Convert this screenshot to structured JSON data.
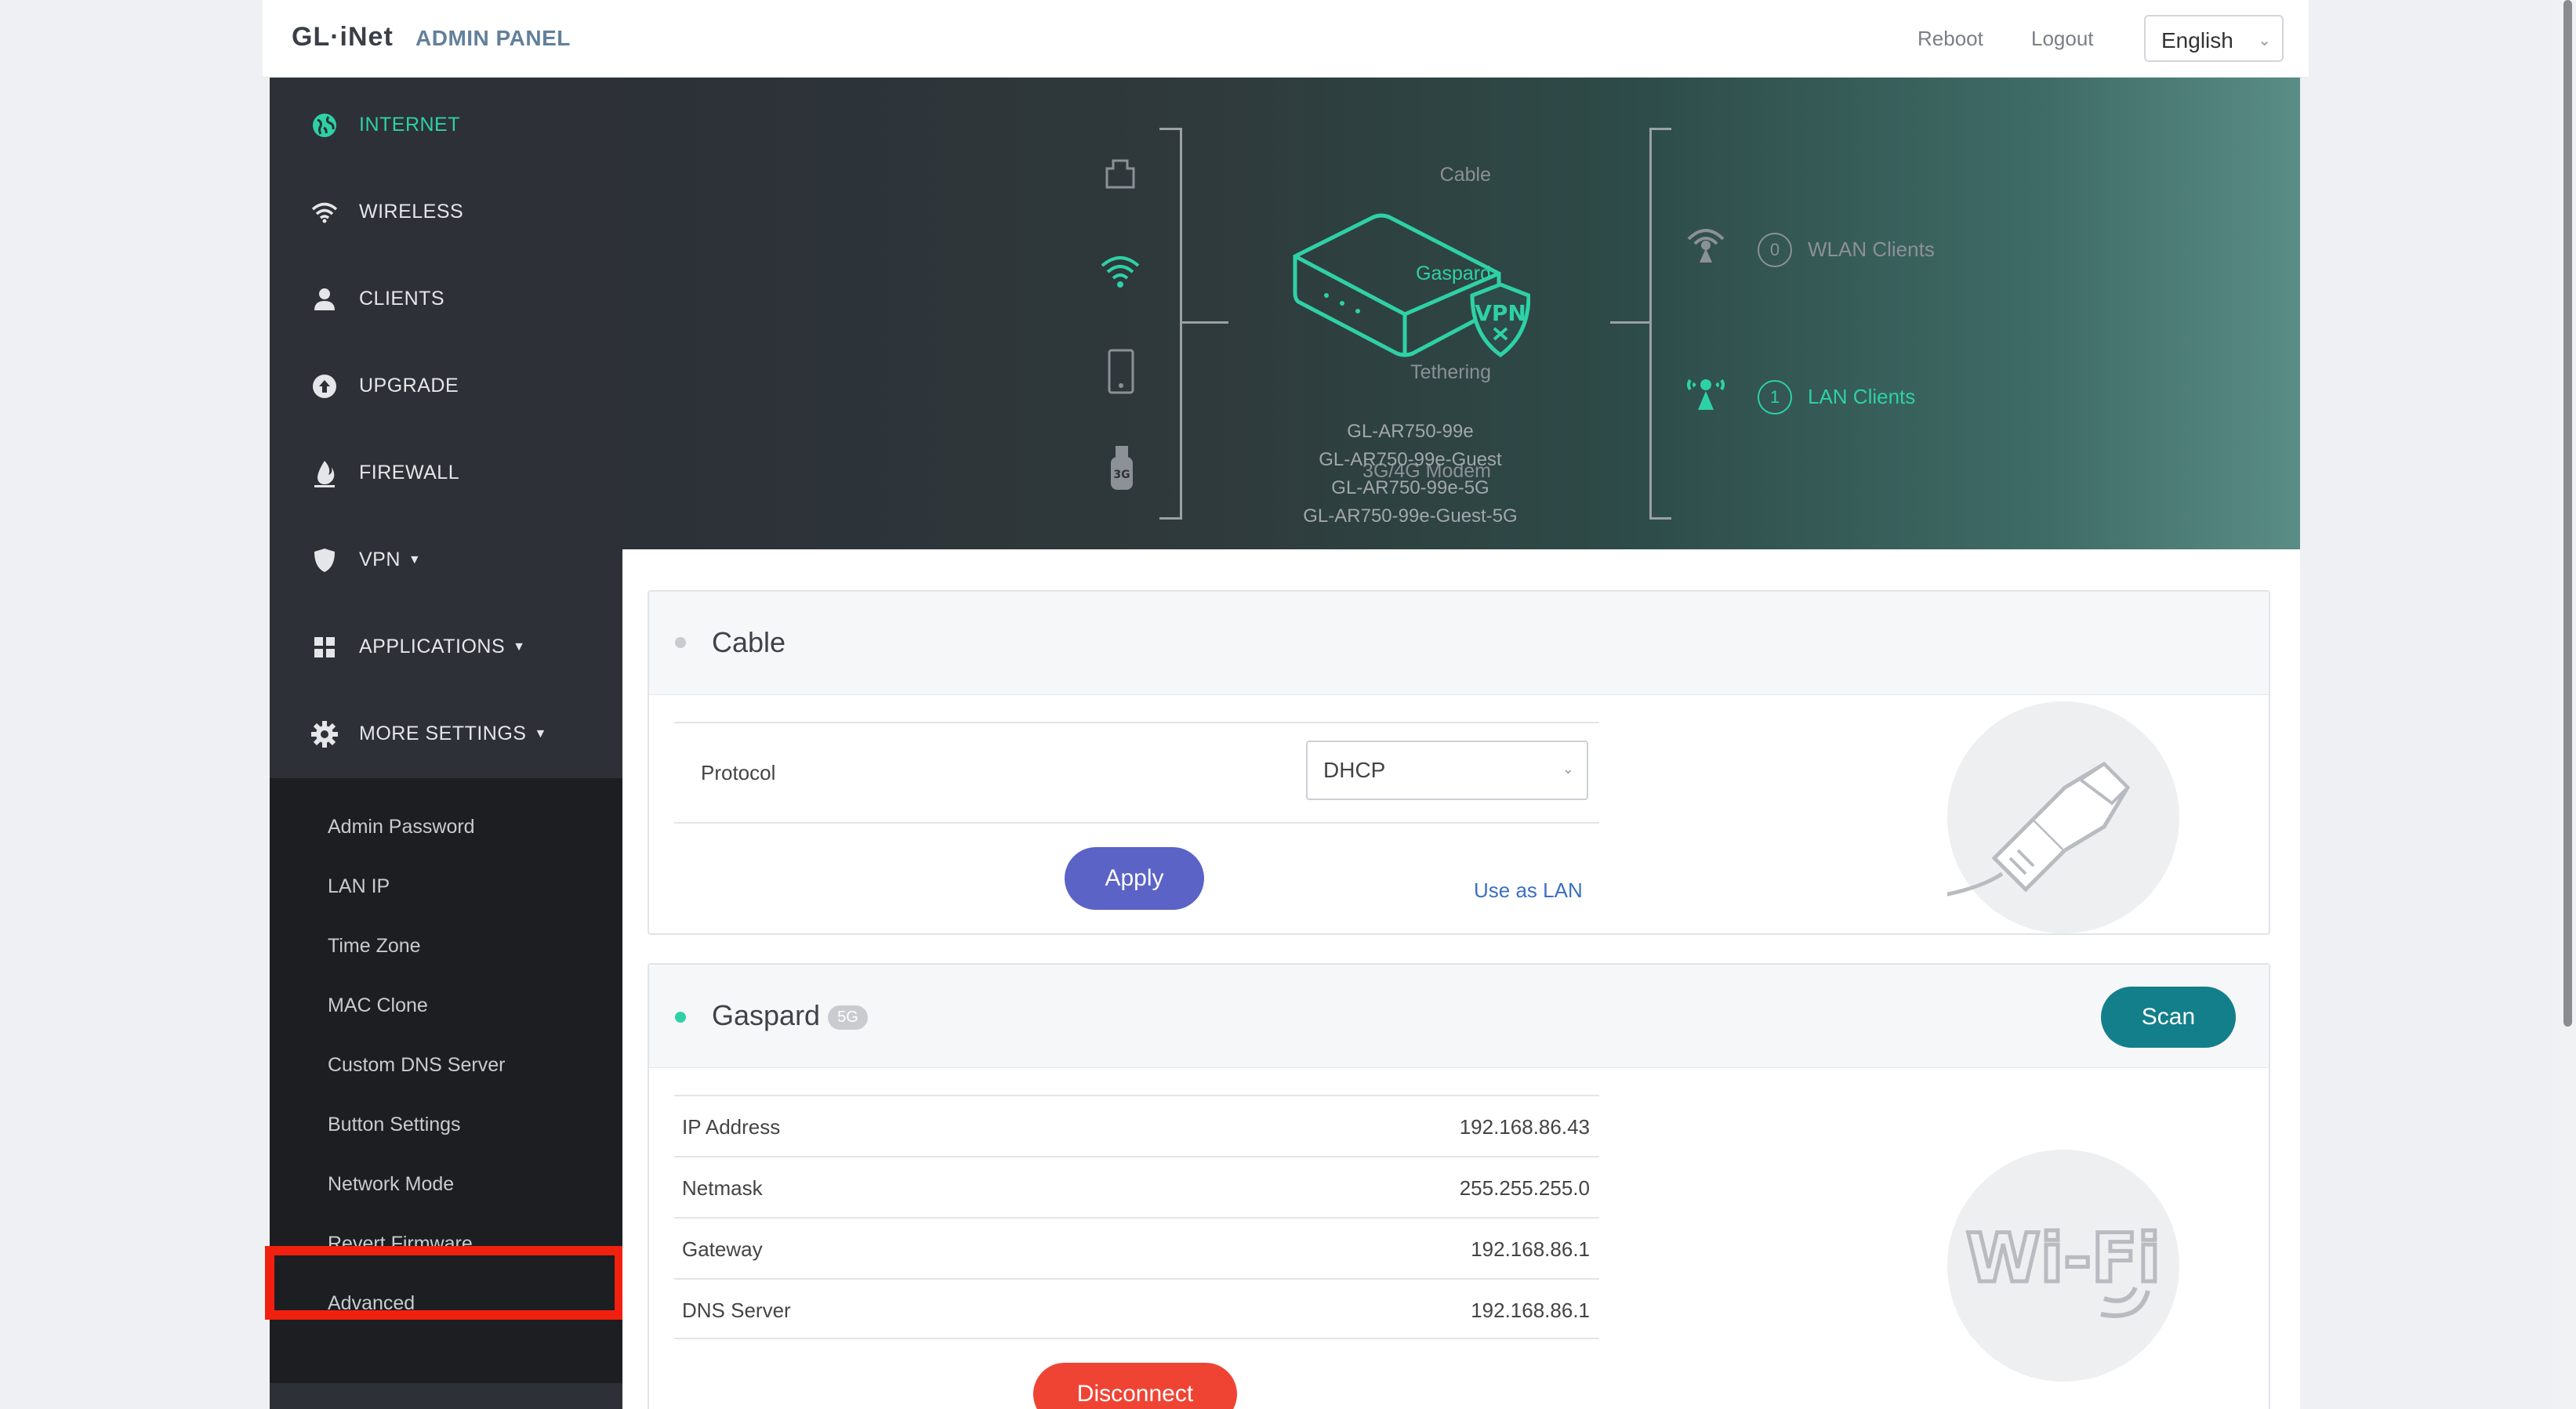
{
  "header": {
    "logo_text": "GL·iNet",
    "title": "ADMIN PANEL",
    "reboot": "Reboot",
    "logout": "Logout",
    "language": "English"
  },
  "sidebar": {
    "items": [
      {
        "label": "INTERNET",
        "icon": "globe-icon",
        "active": true
      },
      {
        "label": "WIRELESS",
        "icon": "wifi-icon"
      },
      {
        "label": "CLIENTS",
        "icon": "user-icon"
      },
      {
        "label": "UPGRADE",
        "icon": "upload-icon"
      },
      {
        "label": "FIREWALL",
        "icon": "flame-icon"
      },
      {
        "label": "VPN",
        "icon": "shield-icon"
      },
      {
        "label": "APPLICATIONS",
        "icon": "grid-icon"
      },
      {
        "label": "MORE SETTINGS",
        "icon": "gear-icon"
      }
    ],
    "sub_items": [
      "Admin Password",
      "LAN IP",
      "Time Zone",
      "MAC Clone",
      "Custom DNS Server",
      "Button Settings",
      "Network Mode",
      "Revert Firmware",
      "Advanced"
    ]
  },
  "hero": {
    "sources": [
      {
        "label": "Cable",
        "icon": "ethernet-port-icon"
      },
      {
        "label": "Gaspard",
        "icon": "wifi-icon",
        "active": true
      },
      {
        "label": "Tethering",
        "icon": "phone-icon"
      },
      {
        "label": "3G/4G Modem",
        "icon": "usb-modem-icon"
      }
    ],
    "router_icon": "router-vpn-icon",
    "vpn_badge": "VPN",
    "modem_badge": "3G",
    "ssids": [
      "GL-AR750-99e",
      "GL-AR750-99e-Guest",
      "GL-AR750-99e-5G",
      "GL-AR750-99e-Guest-5G"
    ],
    "wlan_clients": {
      "count": "0",
      "label": "WLAN Clients"
    },
    "lan_clients": {
      "count": "1",
      "label": "LAN Clients"
    }
  },
  "cable_card": {
    "title": "Cable",
    "protocol_label": "Protocol",
    "protocol_value": "DHCP",
    "apply": "Apply",
    "use_as_lan": "Use as LAN"
  },
  "wifi_card": {
    "title": "Gaspard",
    "band": "5G",
    "scan": "Scan",
    "rows": [
      {
        "key": "IP Address",
        "value": "192.168.86.43"
      },
      {
        "key": "Netmask",
        "value": "255.255.255.0"
      },
      {
        "key": "Gateway",
        "value": "192.168.86.1"
      },
      {
        "key": "DNS Server",
        "value": "192.168.86.1"
      }
    ],
    "disconnect": "Disconnect"
  },
  "colors": {
    "accent": "#2ed1a5",
    "apply": "#5b63c7",
    "scan": "#137f8a",
    "disconnect": "#ef4434",
    "highlight": "#f2200f"
  }
}
